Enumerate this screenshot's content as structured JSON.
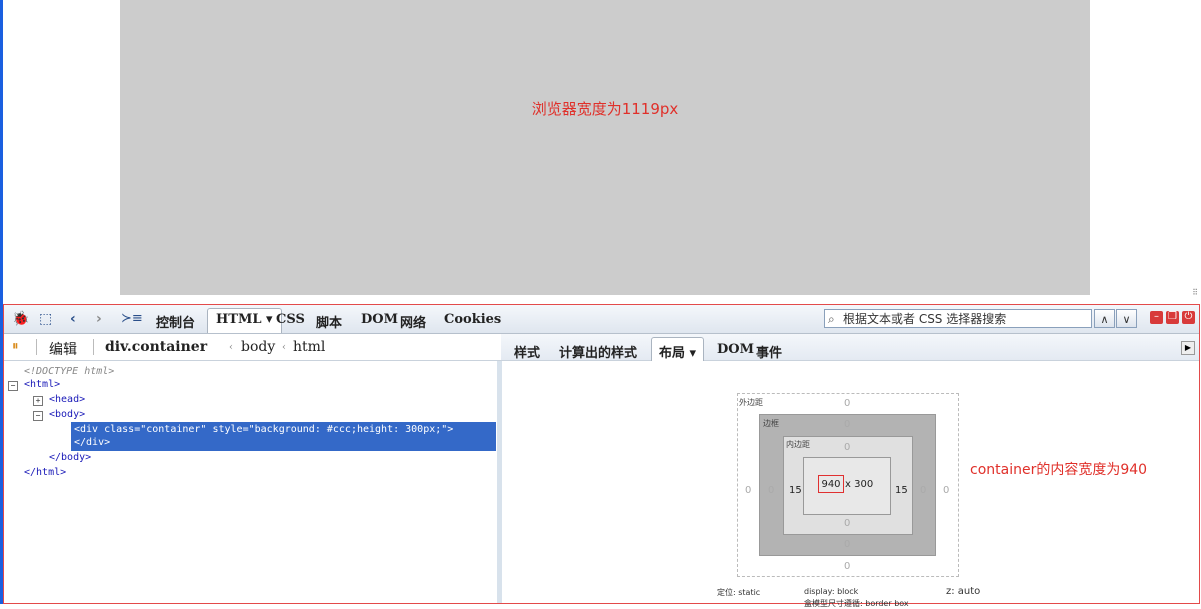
{
  "page": {
    "browser_note": "浏览器宽度为1119px",
    "container_note": "container的内容宽度为940"
  },
  "toolbar": {
    "tabs": [
      {
        "label": "控制台"
      },
      {
        "label": "HTML",
        "caret": "▾"
      },
      {
        "label": "CSS"
      },
      {
        "label": "脚本"
      },
      {
        "label": "DOM"
      },
      {
        "label": "网络"
      },
      {
        "label": "Cookies"
      }
    ],
    "search_placeholder": "根据文本或者 CSS 选择器搜索"
  },
  "subbar": {
    "edit_label": "编辑",
    "breadcrumb": [
      "div.container",
      "body",
      "html"
    ],
    "side_tabs": [
      "样式",
      "计算出的样式",
      "布局",
      "DOM",
      "事件"
    ],
    "side_caret": "▾"
  },
  "html_tree": {
    "doctype": "<!DOCTYPE html>",
    "html_open": "<html>",
    "head": "<head>",
    "body_open": "<body>",
    "selected_line1": "<div class=\"container\" style=\"background: #ccc;height: 300px;\">",
    "selected_line2": "</div>",
    "body_close": "</body>",
    "html_close": "</html>"
  },
  "layout": {
    "margin_label": "外边距",
    "border_label": "边框",
    "padding_label": "内边距",
    "margin": {
      "top": "0",
      "right": "0",
      "bottom": "0",
      "left": "0"
    },
    "border": {
      "top": "0",
      "right": "0",
      "bottom": "0",
      "left": "0"
    },
    "padding": {
      "top": "0",
      "right": "15",
      "bottom": "0",
      "left": "15"
    },
    "content_width": "940",
    "content_height": "x 300",
    "position": "定位: static",
    "display": "display: block",
    "z": "z: auto",
    "box_sizing": "盒模型尺寸遵循: border box"
  }
}
